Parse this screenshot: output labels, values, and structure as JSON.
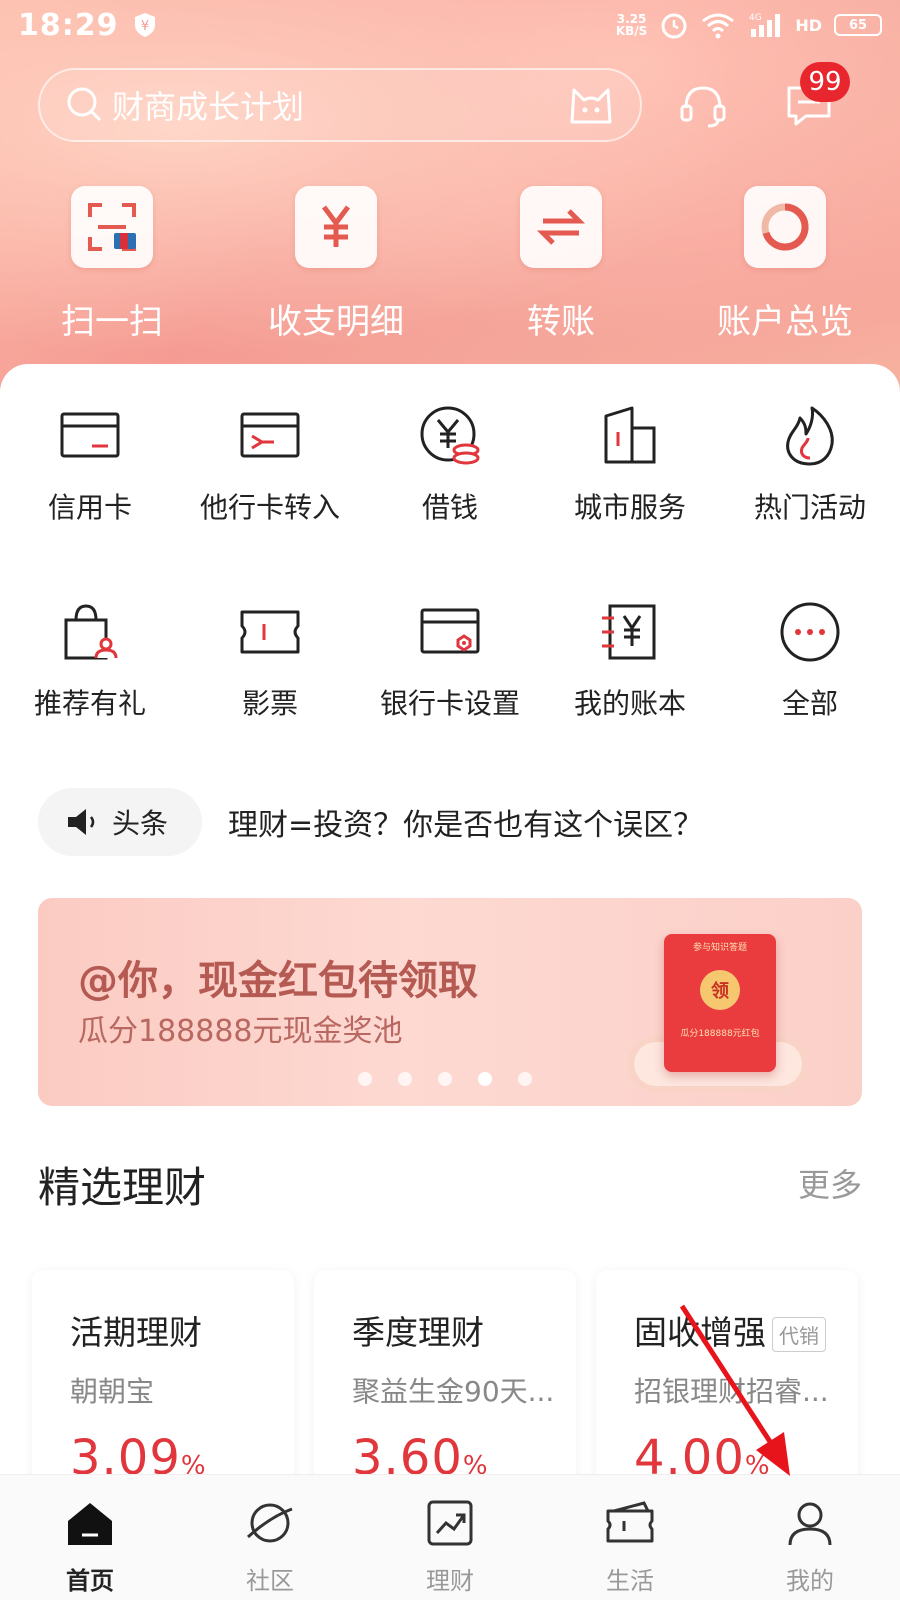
{
  "status": {
    "time": "18:29",
    "net_speed_value": "3.25",
    "net_speed_unit": "KB/S",
    "network": "4G",
    "hd": "HD",
    "battery": "65"
  },
  "search": {
    "placeholder": "财商成长计划"
  },
  "messages_badge": "99",
  "quick_actions": [
    "扫一扫",
    "收支明细",
    "转账",
    "账户总览"
  ],
  "services": {
    "row1": [
      "信用卡",
      "他行卡转入",
      "借钱",
      "城市服务",
      "热门活动"
    ],
    "row2": [
      "推荐有礼",
      "影票",
      "银行卡设置",
      "我的账本",
      "全部"
    ]
  },
  "news": {
    "tag": "头条",
    "headline": "理财=投资？你是否也有这个误区？"
  },
  "banner": {
    "title": "@你，现金红包待领取",
    "subtitle": "瓜分188888元现金奖池",
    "envelope_header": "参与知识答题",
    "envelope_seal": "领",
    "envelope_amount": "瓜分188888元红包",
    "active_dot": 4,
    "dot_count": 5
  },
  "wealth": {
    "title": "精选理财",
    "more": "更多",
    "products": [
      {
        "name": "活期理财",
        "sub": "朝朝宝",
        "rate": "3.09",
        "unit": "%"
      },
      {
        "name": "季度理财",
        "sub": "聚益生金90天...",
        "rate": "3.60",
        "unit": "%"
      },
      {
        "name": "固收增强",
        "tag": "代销",
        "sub": "招银理财招睿...",
        "rate": "4.00",
        "unit": "%"
      }
    ]
  },
  "tabs": [
    "首页",
    "社区",
    "理财",
    "生活",
    "我的"
  ],
  "active_tab": "首页",
  "colors": {
    "accent": "#e0363c",
    "banner_title": "#b45a52",
    "hero": "#f59b93"
  }
}
